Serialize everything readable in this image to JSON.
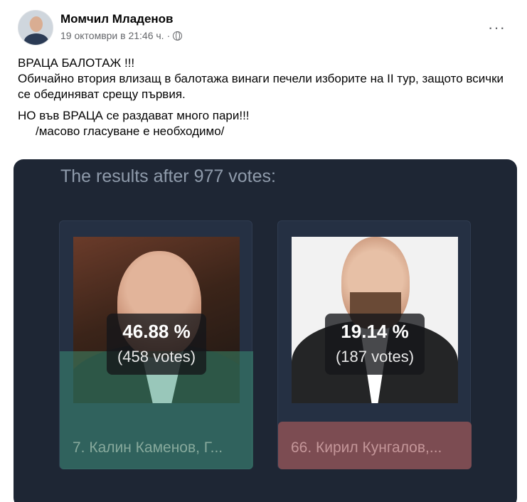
{
  "post": {
    "author": "Момчил Младенов",
    "timestamp": "19 октомври в 21:46 ч.",
    "separator": "·",
    "more_label": "···",
    "lines": [
      "ВРАЦА  БАЛОТАЖ !!!",
      "Обичайно втория влизащ в балотажа винаги печели изборите на II тур, защото всички се обединяват срещу първия.",
      "НО във ВРАЦА се раздават много пари!!!",
      "/масово гласуване е необходимо/"
    ]
  },
  "poll": {
    "title": "The results after 977 votes:",
    "options": [
      {
        "percent": "46.88 %",
        "votes": "(458 votes)",
        "name": "7. Калин Каменов, Г...",
        "leading": true
      },
      {
        "percent": "19.14 %",
        "votes": "(187 votes)",
        "name": "66. Кирил Кунгалов,...",
        "leading": false
      }
    ]
  },
  "colors": {
    "poll_bg": "#1e2634",
    "winner": "#40aa82",
    "loser": "#7c4c52",
    "title_text": "#8f9bab"
  }
}
